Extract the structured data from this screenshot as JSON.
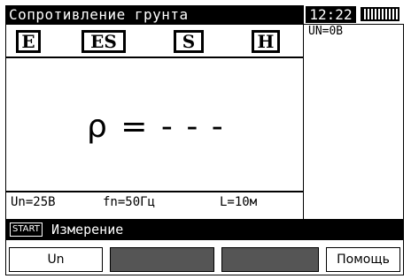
{
  "header": {
    "title": "Сопротивление грунта",
    "time": "12:22"
  },
  "side_panel": {
    "voltage_readout": "UN=0В"
  },
  "tabs": [
    {
      "label": "E"
    },
    {
      "label": "ES"
    },
    {
      "label": "S"
    },
    {
      "label": "H"
    }
  ],
  "reading": {
    "text": "ρ = - - -"
  },
  "params": {
    "un": "Un=25В",
    "fn": "fn=50Гц",
    "length": "L=10м"
  },
  "message": {
    "key": "START",
    "text": "Измерение"
  },
  "function_keys": [
    {
      "label": "Un"
    },
    {
      "label": ""
    },
    {
      "label": ""
    },
    {
      "label": "Помощь"
    }
  ],
  "icons": {
    "battery": "battery-icon"
  }
}
